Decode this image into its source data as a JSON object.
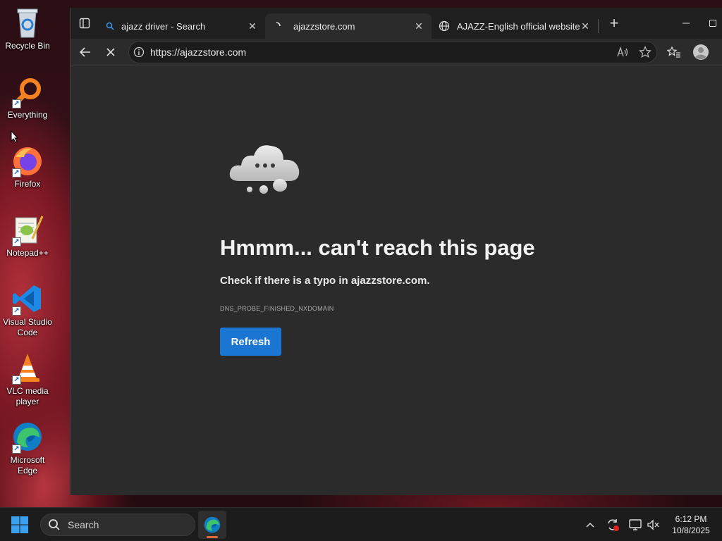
{
  "desktop": {
    "icons": [
      {
        "label": "Recycle Bin",
        "icon": "recycle-bin-icon"
      },
      {
        "label": "Everything",
        "icon": "everything-search-icon"
      },
      {
        "label": "Firefox",
        "icon": "firefox-icon"
      },
      {
        "label": "Notepad++",
        "icon": "notepad-plus-plus-icon"
      },
      {
        "label": "Visual Studio Code",
        "icon": "vscode-icon"
      },
      {
        "label": "VLC media player",
        "icon": "vlc-icon"
      },
      {
        "label": "Microsoft Edge",
        "icon": "edge-icon"
      }
    ]
  },
  "browser": {
    "tabs": [
      {
        "title": "ajazz driver - Search",
        "icon": "search-icon",
        "active": false
      },
      {
        "title": "ajazzstore.com",
        "icon": "loading-icon",
        "active": true
      },
      {
        "title": "AJAZZ-English official website",
        "icon": "globe-icon",
        "active": false
      }
    ],
    "new_tab": "+",
    "address": {
      "url": "https://ajazzstore.com"
    },
    "error": {
      "title": "Hmmm... can't reach this page",
      "message": "Check if there is a typo in ajazzstore.com.",
      "code": "DNS_PROBE_FINISHED_NXDOMAIN",
      "button": "Refresh"
    }
  },
  "taskbar": {
    "search_label": "Search",
    "time": "6:12 PM",
    "date": "10/8/2025"
  },
  "colors": {
    "accent": "#1a76d2",
    "content_bg": "#2b2b2b",
    "tabbar_bg": "#1f1f1f",
    "taskbar_bg": "#1c1c1c"
  }
}
